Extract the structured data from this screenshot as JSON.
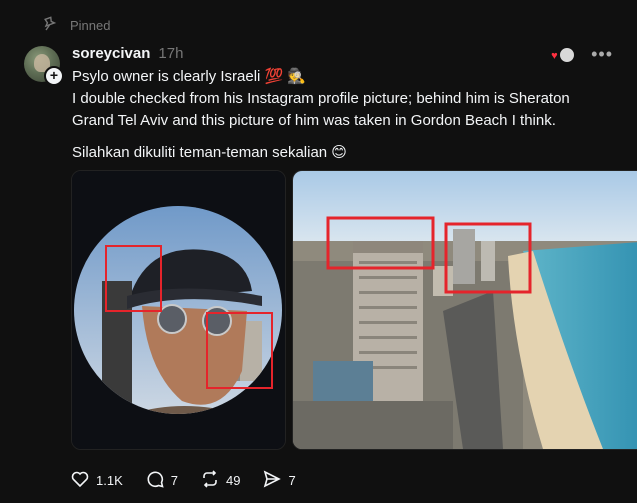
{
  "pinned": {
    "label": "Pinned"
  },
  "post": {
    "username": "soreycivan",
    "time": "17h",
    "line1": "Psylo owner is clearly Israeli 💯 🕵️",
    "line2": "I double checked from his Instagram profile picture; behind him is Sheraton Grand Tel Aviv and this picture of him was taken in Gordon Beach I think.",
    "line3": "Silahkan dikuliti teman-teman sekalian 😊",
    "more_label": "•••"
  },
  "actions": {
    "likes": "1.1K",
    "replies": "7",
    "reposts": "49",
    "shares": "7"
  },
  "colors": {
    "heart": "#ff3040",
    "annotation_box": "#e5242b"
  }
}
